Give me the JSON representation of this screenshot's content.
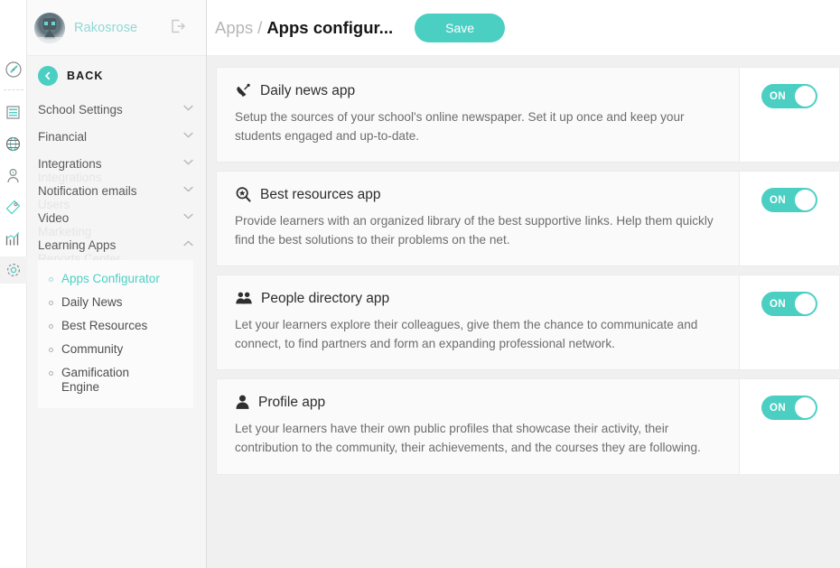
{
  "brand": {
    "accent": "#4ccfc3",
    "username": "Rakosrose"
  },
  "rail": {
    "icons": [
      {
        "name": "compass-icon"
      },
      {
        "name": "content-page-icon"
      },
      {
        "name": "globe-icon"
      },
      {
        "name": "user-icon"
      },
      {
        "name": "tag-icon"
      },
      {
        "name": "analytics-chart-icon"
      },
      {
        "name": "gear-icon"
      }
    ]
  },
  "sidebar": {
    "back_label": "BACK",
    "menu": [
      {
        "label": "School Settings",
        "expanded": false
      },
      {
        "label": "Financial",
        "expanded": false
      },
      {
        "label": "Integrations",
        "expanded": false
      },
      {
        "label": "Notification emails",
        "expanded": false
      },
      {
        "label": "Video",
        "expanded": false
      },
      {
        "label": "Learning Apps",
        "expanded": true
      }
    ],
    "ghost_items": [
      {
        "label": "Integrations"
      },
      {
        "label": "Users"
      },
      {
        "label": "Marketing"
      },
      {
        "label": "Reports Center"
      }
    ],
    "submenu": [
      {
        "label": "Apps Configurator",
        "active": true
      },
      {
        "label": "Daily News",
        "active": false
      },
      {
        "label": "Best Resources",
        "active": false
      },
      {
        "label": "Community",
        "active": false
      },
      {
        "label": "Gamification Engine",
        "active": false
      }
    ]
  },
  "header": {
    "breadcrumb_parent": "Apps",
    "breadcrumb_sep": "/",
    "breadcrumb_current": "Apps configur...",
    "save_label": "Save"
  },
  "apps": [
    {
      "icon": "satellite-dish-icon",
      "title": "Daily news app",
      "description": "Setup the sources of your school's online newspaper. Set it up once and keep your students engaged and up-to-date.",
      "toggle_label": "ON",
      "toggle_on": true
    },
    {
      "icon": "magnifier-star-icon",
      "title": "Best resources app",
      "description": "Provide learners with an organized library of the best supportive links. Help them quickly find the best solutions to their problems on the net.",
      "toggle_label": "ON",
      "toggle_on": true
    },
    {
      "icon": "people-group-icon",
      "title": "People directory app",
      "description": "Let your learners explore their colleagues, give them the chance to communicate and connect, to find partners and form an expanding professional network.",
      "toggle_label": "ON",
      "toggle_on": true
    },
    {
      "icon": "person-profile-icon",
      "title": "Profile app",
      "description": "Let your learners have their own public profiles that showcase their activity, their contribution to the community, their achievements, and the courses they are following.",
      "toggle_label": "ON",
      "toggle_on": true
    }
  ]
}
